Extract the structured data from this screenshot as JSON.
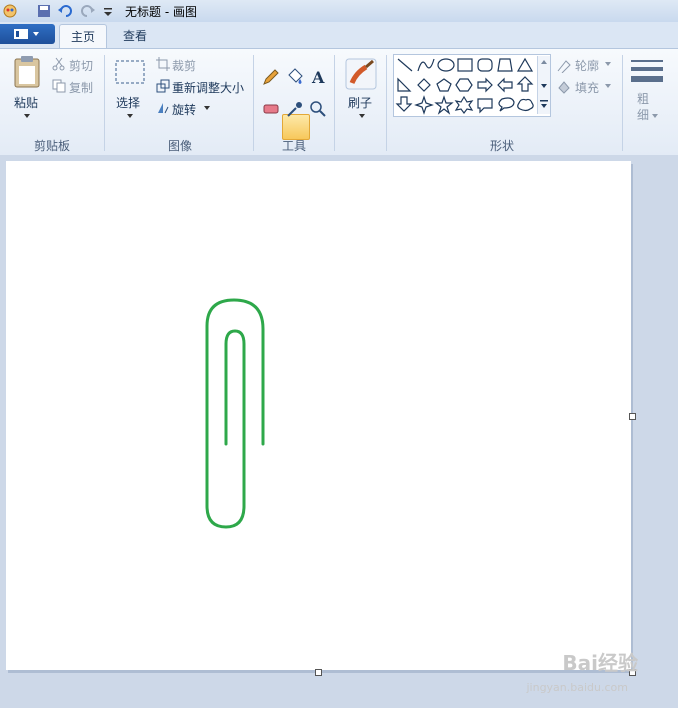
{
  "window": {
    "title": "无标题 - 画图"
  },
  "tabs": [
    {
      "label": "主页",
      "active": true
    },
    {
      "label": "查看",
      "active": false
    }
  ],
  "clipboard": {
    "paste": "粘贴",
    "cut": "剪切",
    "copy": "复制",
    "group": "剪贴板"
  },
  "image": {
    "select": "选择",
    "crop": "裁剪",
    "resize": "重新调整大小",
    "rotate": "旋转",
    "group": "图像"
  },
  "tools": {
    "group": "工具",
    "selected": "fill-icon"
  },
  "brushes": {
    "label": "刷子"
  },
  "shapes": {
    "group": "形状",
    "outline": "轮廓",
    "fill": "填充"
  },
  "size": {
    "label": "粗细"
  },
  "drawing": {
    "shape": "paperclip",
    "color": "#2ea84a"
  },
  "colors": {
    "accent": "#1e4f9a",
    "ribbon_text": "#1e395b"
  },
  "watermark": {
    "main": "Bai经验",
    "sub": "jingyan.baidu.com"
  }
}
